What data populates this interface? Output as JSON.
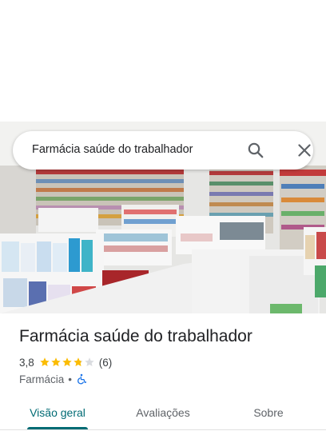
{
  "search": {
    "query": "Farmácia saúde do trabalhador",
    "search_icon": "search-icon",
    "close_icon": "close-icon"
  },
  "photo": {
    "subject": "pharmacy-interior-photo"
  },
  "place": {
    "title": "Farmácia saúde do trabalhador",
    "rating": "3,8",
    "rating_value": 3.8,
    "max_rating": 5,
    "review_count": "(6)",
    "category": "Farmácia",
    "separator": "•",
    "accessibility_icon": "wheelchair-accessible-icon"
  },
  "tabs": [
    {
      "label": "Visão geral",
      "active": true
    },
    {
      "label": "Avaliações",
      "active": false
    },
    {
      "label": "Sobre",
      "active": false
    }
  ],
  "colors": {
    "accent": "#006b74",
    "star_filled": "#fbbc04",
    "star_empty": "#dadce0",
    "accessibility": "#1a73e8",
    "text_primary": "#202124",
    "text_secondary": "#5f6368"
  }
}
